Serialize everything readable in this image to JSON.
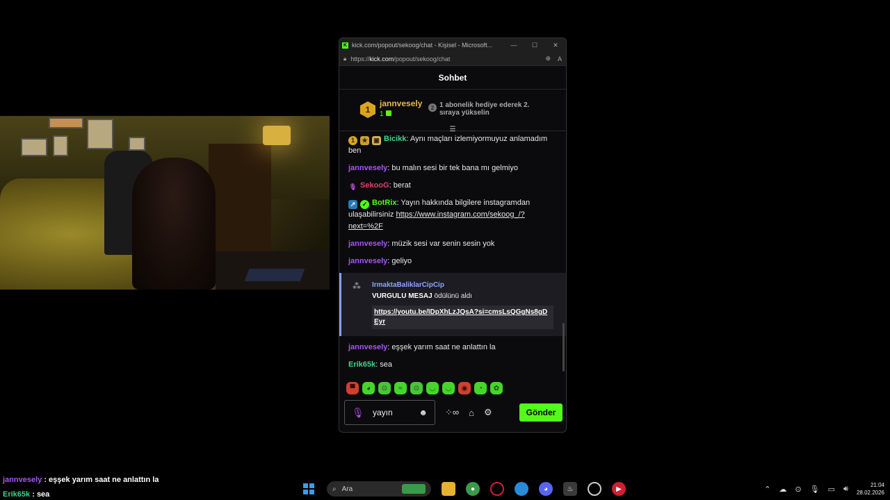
{
  "browser": {
    "window_title": "kick.com/popout/sekoog/chat - Kişisel - Microsoft...",
    "url_prefix": "https://",
    "url_domain": "kick.com",
    "url_path": "/popout/sekoog/chat"
  },
  "chat": {
    "header": "Sohbet",
    "top_gifter": {
      "rank": "1",
      "name": "jannvesely",
      "count": "1",
      "next_rank": "2",
      "next_rank_text": "1 abonelik hediye ederek 2. sıraya yükselin"
    },
    "messages": [
      {
        "user": "Bicikk",
        "sep": ": ",
        "text": "Aynı maçları izlemiyormuyuz anlamadım ben"
      },
      {
        "user": "jannvesely",
        "sep": ": ",
        "text": "bu malın sesi bir tek bana mı gelmiyo"
      },
      {
        "user": "SekooG",
        "sep": ": ",
        "text": "berat"
      },
      {
        "user": "BotRix",
        "sep": ": ",
        "text": "Yayın hakkında bilgilere instagramdan ulaşabilirsiniz ",
        "link": "https://www.instagram.com/sekoog_/?next=%2F"
      },
      {
        "user": "jannvesely",
        "sep": ": ",
        "text": "müzik sesi var senin sesin yok"
      },
      {
        "user": "jannvesely",
        "sep": ": ",
        "text": "geliyo"
      },
      {
        "user": "jannvesely",
        "sep": ": ",
        "text": "eşşek yarım saat ne anlattın la"
      },
      {
        "user": "Erik65k",
        "sep": ": ",
        "text": "sea"
      }
    ],
    "highlight": {
      "user": "IrmaktaBaliklarCipCip",
      "reward_name": "VURGULU MESAJ",
      "reward_text": " ödülünü aldı",
      "link": "https://youtu.be/IDpXhLzJQsA?si=cmsLsQGgNs8gDEyr"
    },
    "input_value": "yayın",
    "send_label": "Gönder"
  },
  "overlay_chat": [
    {
      "user": "jannvesely",
      "sep": " : ",
      "text": "eşşek yarım saat ne anlattın la"
    },
    {
      "user": "Erik65k",
      "sep": " : ",
      "text": "sea"
    }
  ],
  "taskbar": {
    "search_placeholder": "Ara",
    "time": "21:04",
    "date": "28.02.2026"
  },
  "colors": {
    "kick_green": "#53fc18",
    "username_purple": "#a855f7",
    "gold": "#e8b84a"
  }
}
